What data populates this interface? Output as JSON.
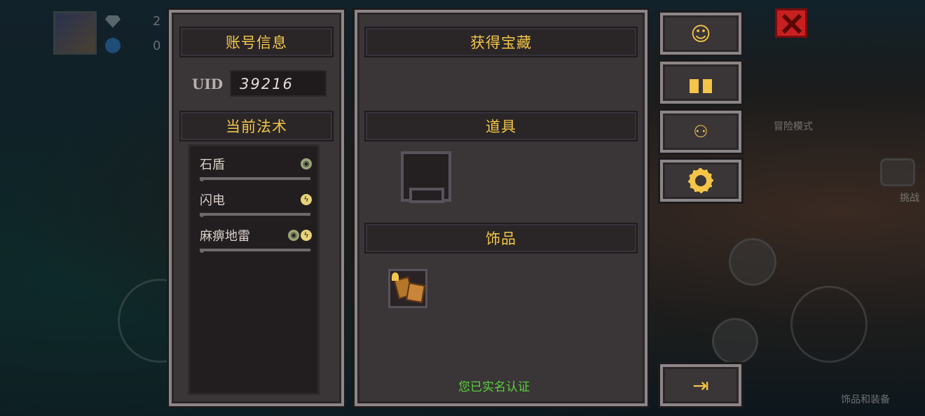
{
  "hud": {
    "gems": "2",
    "coins": "0",
    "mode_label": "冒险模式",
    "challenge_label": "挑战",
    "accessory_label": "饰品和装备"
  },
  "account_panel": {
    "title": "账号信息",
    "uid_label": "UID",
    "uid_value": "39216",
    "spells_title": "当前法术",
    "spells": [
      {
        "name": "石盾",
        "icons": [
          "shield-icon"
        ]
      },
      {
        "name": "闪电",
        "icons": [
          "lightning-icon"
        ]
      },
      {
        "name": "麻痹地雷",
        "icons": [
          "shield-icon",
          "lightning-icon"
        ]
      }
    ]
  },
  "treasure_panel": {
    "title": "获得宝藏",
    "items_title": "道具",
    "accessories_title": "饰品",
    "verified_text": "您已实名认证"
  },
  "side_buttons": [
    {
      "name": "customer-service-button",
      "icon": "headset-icon"
    },
    {
      "name": "gift-button",
      "icon": "gift-icon"
    },
    {
      "name": "friends-button",
      "icon": "badge-icon"
    },
    {
      "name": "settings-button",
      "icon": "gear-icon"
    },
    {
      "name": "logout-button",
      "icon": "exit-icon"
    }
  ],
  "colors": {
    "accent": "#f3c548",
    "panel": "#3a3537",
    "verified": "#58d13a"
  }
}
